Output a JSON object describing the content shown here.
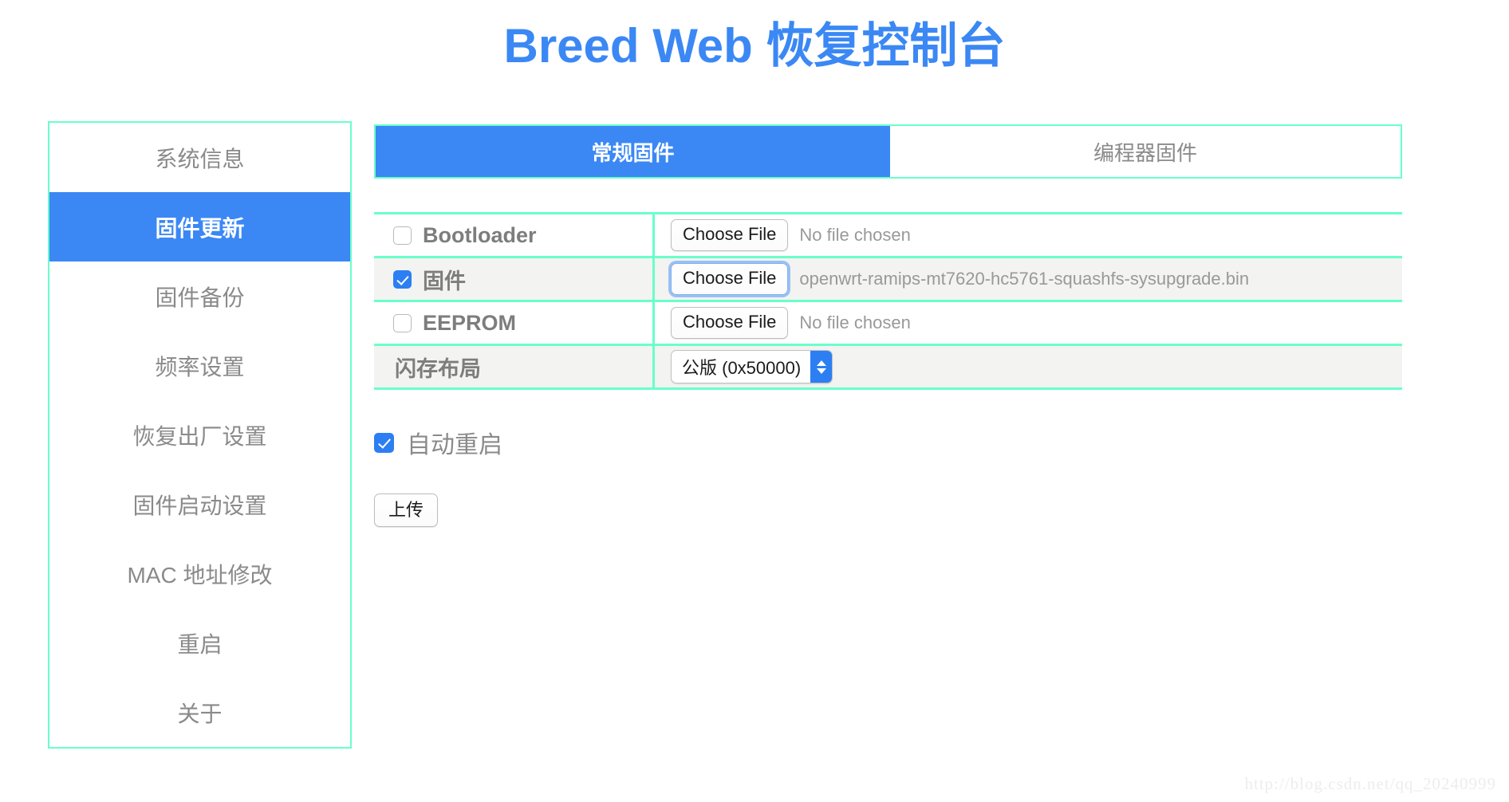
{
  "header": {
    "title": "Breed Web 恢复控制台",
    "title_color": "#3B88F5"
  },
  "theme": {
    "accent_blue": "#3B88F5",
    "border_mint": "#69FFCB",
    "row_alt_bg": "#f3f3f1",
    "muted_text": "#8a8a8a"
  },
  "sidebar": {
    "items": [
      {
        "label": "系统信息",
        "active": false
      },
      {
        "label": "固件更新",
        "active": true
      },
      {
        "label": "固件备份",
        "active": false
      },
      {
        "label": "频率设置",
        "active": false
      },
      {
        "label": "恢复出厂设置",
        "active": false
      },
      {
        "label": "固件启动设置",
        "active": false
      },
      {
        "label": "MAC 地址修改",
        "active": false
      },
      {
        "label": "重启",
        "active": false
      },
      {
        "label": "关于",
        "active": false
      }
    ]
  },
  "main": {
    "tabs": [
      {
        "label": "常规固件",
        "active": true
      },
      {
        "label": "编程器固件",
        "active": false
      }
    ],
    "rows": [
      {
        "type": "file",
        "label": "Bootloader",
        "checked": false,
        "button_label": "Choose File",
        "file_name": "No file chosen",
        "focused": false,
        "alt": false
      },
      {
        "type": "file",
        "label": "固件",
        "checked": true,
        "button_label": "Choose File",
        "file_name": "openwrt-ramips-mt7620-hc5761-squashfs-sysupgrade.bin",
        "focused": true,
        "alt": true
      },
      {
        "type": "file",
        "label": "EEPROM",
        "checked": false,
        "button_label": "Choose File",
        "file_name": "No file chosen",
        "focused": false,
        "alt": false
      },
      {
        "type": "select",
        "label": "闪存布局",
        "selected": "公版 (0x50000)",
        "alt": true
      }
    ],
    "auto_reboot": {
      "label": "自动重启",
      "checked": true
    },
    "upload_button": {
      "label": "上传"
    }
  },
  "watermark": {
    "text": "http://blog.csdn.net/qq_20240999"
  }
}
